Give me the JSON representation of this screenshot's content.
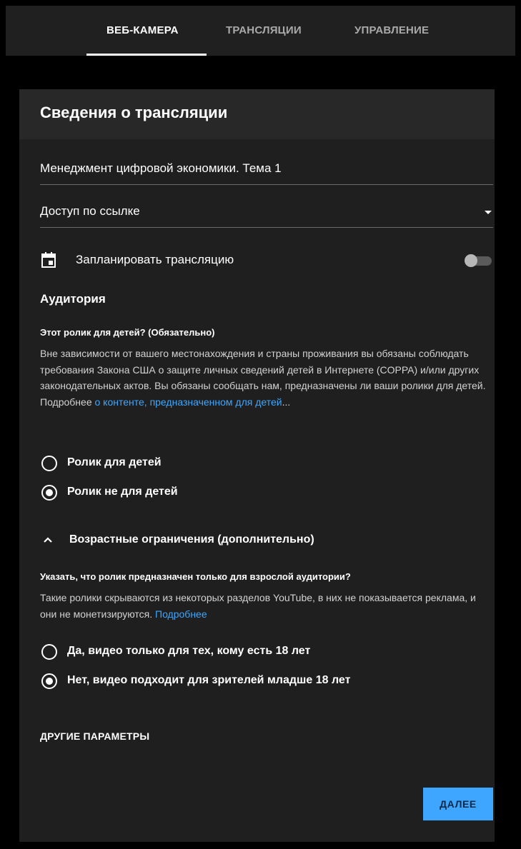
{
  "tabs": [
    {
      "label": "ВЕБ-КАМЕРА",
      "active": true
    },
    {
      "label": "ТРАНСЛЯЦИИ",
      "active": false
    },
    {
      "label": "УПРАВЛЕНИЕ",
      "active": false
    }
  ],
  "panel": {
    "title": "Сведения о трансляции",
    "stream_title_value": "Менеджмент цифровой экономики. Тема 1",
    "visibility_value": "Доступ по ссылке",
    "schedule_label": "Запланировать трансляцию",
    "schedule_enabled": false,
    "audience": {
      "heading": "Аудитория",
      "question": "Этот ролик для детей? (Обязательно)",
      "text": "Вне зависимости от вашего местонахождения и страны проживания вы обязаны соблюдать требования Закона США о защите личных сведений детей в Интернете (COPPA) и/или других законодательных актов. Вы обязаны сообщать нам, предназначены ли ваши ролики для детей. Подробнее ",
      "link_text": "о контенте, предназначенном для детей",
      "ellipsis": "...",
      "options": [
        {
          "label": "Ролик для детей",
          "selected": false
        },
        {
          "label": "Ролик не для детей",
          "selected": true
        }
      ]
    },
    "age": {
      "toggle_label": "Возрастные ограничения (дополнительно)",
      "question": "Указать, что ролик предназначен только для взрослой аудитории?",
      "text": "Такие ролики скрываются из некоторых разделов YouTube, в них не показывается реклама, и они не монетизируются. ",
      "link_text": "Подробнее",
      "options": [
        {
          "label": "Да, видео только для тех, кому есть 18 лет",
          "selected": false
        },
        {
          "label": "Нет, видео подходит для зрителей младше 18 лет",
          "selected": true
        }
      ]
    },
    "other_params": "ДРУГИЕ ПАРАМЕТРЫ",
    "next_button": "ДАЛЕЕ"
  },
  "colors": {
    "accent": "#3ea6ff",
    "panel_bg": "#1f1f1f",
    "header_bg": "#282828",
    "topbar_bg": "#202020"
  },
  "icons": [
    "calendar-icon",
    "dropdown-caret-icon",
    "chevron-up-icon"
  ]
}
